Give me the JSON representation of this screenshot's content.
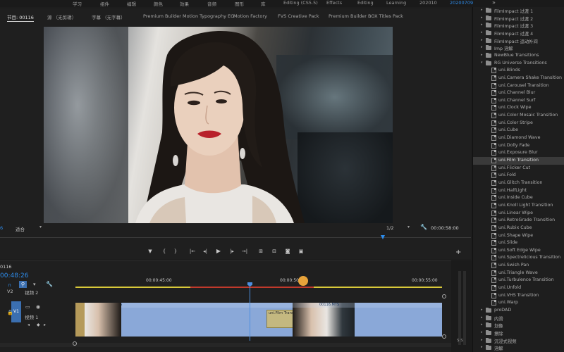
{
  "workspace_bar": {
    "items": [
      {
        "label": "学习",
        "active": false
      },
      {
        "label": "组件",
        "active": false
      },
      {
        "label": "编辑",
        "active": false
      },
      {
        "label": "颜色",
        "active": false
      },
      {
        "label": "效果",
        "active": false
      },
      {
        "label": "音频",
        "active": false
      },
      {
        "label": "图形",
        "active": false
      },
      {
        "label": "库",
        "active": false
      },
      {
        "label": "Editing (CS5.5)",
        "active": false
      },
      {
        "label": "Effects",
        "active": false
      },
      {
        "label": "Editing",
        "active": false
      },
      {
        "label": "Learning",
        "active": false
      },
      {
        "label": "202010",
        "active": false
      },
      {
        "label": "20200709",
        "active": true
      }
    ],
    "more": "»"
  },
  "monitor": {
    "tabs": [
      {
        "label": "节目: 00116",
        "active": true
      },
      {
        "label": "源 （无剪辑）",
        "active": false
      },
      {
        "label": "字幕 （无字幕）",
        "active": false
      },
      {
        "label": "Premium Builder Motion Typography EG",
        "active": false
      },
      {
        "label": "Motion Factory",
        "active": false
      },
      {
        "label": "FVS Creative Pack",
        "active": false
      },
      {
        "label": "Premium Builder BOX Titles Pack",
        "active": false
      }
    ],
    "timecode_left": "6",
    "fit_label": "适合",
    "resolution": "1/2",
    "duration": "00:00:58:00",
    "transport_icons": [
      "marker-icon",
      "in-point-icon",
      "out-point-icon",
      "go-to-in-icon",
      "step-back-icon",
      "play-icon",
      "step-forward-icon",
      "go-to-out-icon",
      "lift-icon",
      "extract-icon",
      "export-frame-icon",
      "compare-icon"
    ],
    "add_button": "+"
  },
  "effects_panel": {
    "items": [
      {
        "label": "FilmImpact 过渡 1",
        "type": "folder",
        "indent": 0,
        "open": false
      },
      {
        "label": "FilmImpact 过渡 2",
        "type": "folder",
        "indent": 0,
        "open": false
      },
      {
        "label": "FilmImpact 过渡 3",
        "type": "folder",
        "indent": 0,
        "open": false
      },
      {
        "label": "FilmImpact 过渡 4",
        "type": "folder",
        "indent": 0,
        "open": false
      },
      {
        "label": "FilmImpact 运动补间",
        "type": "folder",
        "indent": 0,
        "open": false
      },
      {
        "label": "Imp 溶解",
        "type": "folder",
        "indent": 0,
        "open": false
      },
      {
        "label": "NewBlue Transitions",
        "type": "folder",
        "indent": 0,
        "open": false
      },
      {
        "label": "RG Universe Transitions",
        "type": "folder",
        "indent": 0,
        "open": true
      },
      {
        "label": "uni.Blinds",
        "type": "effect",
        "indent": 1
      },
      {
        "label": "uni.Camera Shake Transition",
        "type": "effect",
        "indent": 1
      },
      {
        "label": "uni.Carousel Transition",
        "type": "effect",
        "indent": 1
      },
      {
        "label": "uni.Channel Blur",
        "type": "effect",
        "indent": 1
      },
      {
        "label": "uni.Channel Surf",
        "type": "effect",
        "indent": 1
      },
      {
        "label": "uni.Clock Wipe",
        "type": "effect",
        "indent": 1
      },
      {
        "label": "uni.Color Mosaic Transition",
        "type": "effect",
        "indent": 1
      },
      {
        "label": "uni.Color Stripe",
        "type": "effect",
        "indent": 1
      },
      {
        "label": "uni.Cube",
        "type": "effect",
        "indent": 1
      },
      {
        "label": "uni.Diamond Wave",
        "type": "effect",
        "indent": 1
      },
      {
        "label": "uni.Dolly Fade",
        "type": "effect",
        "indent": 1
      },
      {
        "label": "uni.Exposure Blur",
        "type": "effect",
        "indent": 1
      },
      {
        "label": "uni.Film Transition",
        "type": "effect",
        "indent": 1,
        "selected": true
      },
      {
        "label": "uni.Flicker Cut",
        "type": "effect",
        "indent": 1
      },
      {
        "label": "uni.Fold",
        "type": "effect",
        "indent": 1
      },
      {
        "label": "uni.Glitch Transition",
        "type": "effect",
        "indent": 1
      },
      {
        "label": "uni.HalfLight",
        "type": "effect",
        "indent": 1
      },
      {
        "label": "uni.Inside Cube",
        "type": "effect",
        "indent": 1
      },
      {
        "label": "uni.Knoll Light Transition",
        "type": "effect",
        "indent": 1
      },
      {
        "label": "uni.Linear Wipe",
        "type": "effect",
        "indent": 1
      },
      {
        "label": "uni.RetroGrade Transition",
        "type": "effect",
        "indent": 1
      },
      {
        "label": "uni.Rubix Cube",
        "type": "effect",
        "indent": 1
      },
      {
        "label": "uni.Shape Wipe",
        "type": "effect",
        "indent": 1
      },
      {
        "label": "uni.Slide",
        "type": "effect",
        "indent": 1
      },
      {
        "label": "uni.Soft Edge Wipe",
        "type": "effect",
        "indent": 1
      },
      {
        "label": "uni.Spectrelicious Transition",
        "type": "effect",
        "indent": 1
      },
      {
        "label": "uni.Swish Pan",
        "type": "effect",
        "indent": 1
      },
      {
        "label": "uni.Triangle Wave",
        "type": "effect",
        "indent": 1
      },
      {
        "label": "uni.Turbulence Transition",
        "type": "effect",
        "indent": 1
      },
      {
        "label": "uni.Unfold",
        "type": "effect",
        "indent": 1
      },
      {
        "label": "uni.VHS Transition",
        "type": "effect",
        "indent": 1
      },
      {
        "label": "uni.Warp",
        "type": "effect",
        "indent": 1
      },
      {
        "label": "proDAD",
        "type": "folder",
        "indent": 0,
        "open": false
      },
      {
        "label": "内滑",
        "type": "folder",
        "indent": 0,
        "open": false
      },
      {
        "label": "划像",
        "type": "folder",
        "indent": 0,
        "open": false
      },
      {
        "label": "擦除",
        "type": "folder",
        "indent": 0,
        "open": false
      },
      {
        "label": "沉浸式视频",
        "type": "folder",
        "indent": 0,
        "open": false
      },
      {
        "label": "溶解",
        "type": "folder",
        "indent": 0,
        "open": false
      }
    ]
  },
  "timeline": {
    "sequence_name": "0116",
    "current_time": "00:48:26",
    "ruler_labels": [
      "00:00:45:00",
      "00:00:50:00",
      "00:00:55:00"
    ],
    "tracks": {
      "v2_label": "V2",
      "v2_name": "视频 2",
      "v1_label": "V1",
      "v1_name": "视频 1"
    },
    "clips": [
      {
        "label": "00116.MTS"
      },
      {
        "label": "00116.MTS"
      }
    ],
    "transition_label": "uni.Film Transition",
    "meter_label": "S S",
    "colors": {
      "clip": "#8aa8d8",
      "playhead": "#4d8fe0",
      "work_area": "#d8c83a",
      "render_bar": "#c0392b",
      "marker": "#e8a33a",
      "accent": "#2d8ceb"
    }
  }
}
